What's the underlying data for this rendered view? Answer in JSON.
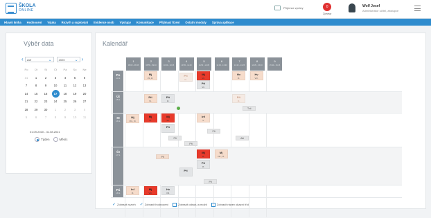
{
  "header": {
    "logo_title": "ŠKOLA",
    "logo_subtitle": "ONLINE",
    "messages_label": "Příjemce zprávy",
    "notif_count": "0",
    "notif_label": "Zprávy",
    "user_name": "Wolf Josef",
    "user_role": "Administrátor učitel, zástupce"
  },
  "nav": [
    "Hlavní kniha",
    "Hodnocení",
    "Výuka",
    "Rozvrh a suplování",
    "Evidence osob",
    "Výstupy",
    "Komunikace",
    "Přijímací řízení",
    "Ostatní moduly",
    "Správa aplikace"
  ],
  "date_picker": {
    "title": "Výběr data",
    "month": "září",
    "year": "2020",
    "weekdays": [
      "Po",
      "Út",
      "St",
      "Čt",
      "Pá",
      "So",
      "Ne"
    ],
    "weeks": [
      [
        "31",
        "1",
        "2",
        "3",
        "4",
        "5",
        "6"
      ],
      [
        "7",
        "8",
        "9",
        "10",
        "11",
        "12",
        "13"
      ],
      [
        "14",
        "15",
        "16",
        "17",
        "18",
        "19",
        "20"
      ],
      [
        "21",
        "22",
        "23",
        "24",
        "25",
        "26",
        "27"
      ],
      [
        "28",
        "29",
        "30",
        "1",
        "2",
        "3",
        "4"
      ],
      [
        "5",
        "6",
        "7",
        "8",
        "9",
        "10",
        "11"
      ]
    ],
    "today": "17",
    "range": "01.09.2020 - 31.08.2021",
    "radio_week": "Týden",
    "radio_month": "Měsíc"
  },
  "calendar": {
    "title": "Kalendář",
    "columns": [
      {
        "n": "1",
        "t": "08:00 - 08:45"
      },
      {
        "n": "2",
        "t": "08:55 - 09:40"
      },
      {
        "n": "3",
        "t": "10:00 - 10:45"
      },
      {
        "n": "4",
        "t": "10:55 - 11:40"
      },
      {
        "n": "5",
        "t": "11:50 - 12:35"
      },
      {
        "n": "6",
        "t": "12:45 - 13:30"
      },
      {
        "n": "7",
        "t": "13:40 - 14:25"
      },
      {
        "n": "8",
        "t": "14:35 - 15:20"
      },
      {
        "n": "9",
        "t": "15:30 - 16:15"
      }
    ],
    "days": [
      {
        "d": "Po",
        "date": "14.9."
      },
      {
        "d": "Út",
        "date": "15.9."
      },
      {
        "d": "St",
        "date": "16.9."
      },
      {
        "d": "Čt",
        "date": "17.9."
      },
      {
        "d": "Pá",
        "date": "18.9."
      }
    ],
    "lessons": [
      {
        "s": "Mj",
        "l": "VII.,IX."
      },
      {
        "s": "Pří",
        "l": "IX."
      },
      {
        "s": "Mj",
        "l": "VII."
      },
      {
        "s": "Pří",
        "l": "VII."
      },
      {
        "s": "Hv",
        "l": "IX."
      },
      {
        "s": "Hv",
        "l": "VIII."
      },
      {
        "s": "Pří",
        "l": "VI."
      },
      {
        "s": "Pří",
        "l": "IX."
      },
      {
        "s": "Pří",
        "l": "IX."
      },
      {
        "s": "Tvč",
        "l": ""
      },
      {
        "s": "Mj",
        "l": "VIII., IX."
      },
      {
        "s": "Mj",
        "l": "VI."
      },
      {
        "s": "Mj",
        "l": "VII."
      },
      {
        "s": "Pří",
        "l": ""
      },
      {
        "s": "Inf",
        "l": "V."
      },
      {
        "s": "Pří",
        "l": ""
      },
      {
        "s": "Pří",
        "l": ""
      },
      {
        "s": "Pří",
        "l": ""
      },
      {
        "s": "Pří",
        "l": ""
      },
      {
        "s": "Aki",
        "l": ""
      },
      {
        "s": "Pří",
        "l": ""
      },
      {
        "s": "Mj",
        "l": "IX."
      },
      {
        "s": "Mj",
        "l": "VIII., IX."
      },
      {
        "s": "Pří",
        "l": "IX."
      },
      {
        "s": "Pří",
        "l": ""
      },
      {
        "s": "Inf",
        "l": "IX."
      },
      {
        "s": "Mj",
        "l": "VIII."
      },
      {
        "s": "Hv",
        "l": "VIII."
      }
    ]
  },
  "legend": [
    "Zobrazit rozvrh",
    "Zobrazit hodnocení",
    "Zobrazit odsutu a možtí",
    "Zobrazit název okazní tříd"
  ],
  "colors": {
    "accent": "#2f8cce",
    "red": "#e83a2b",
    "peach": "#f6dccb"
  }
}
